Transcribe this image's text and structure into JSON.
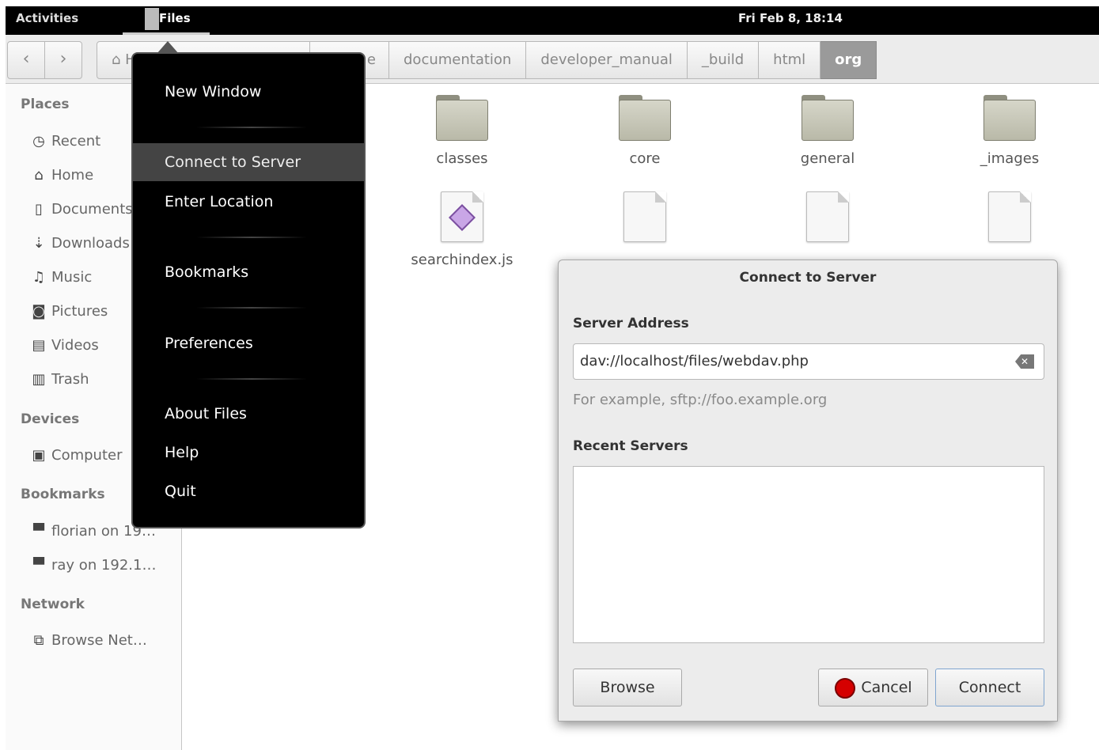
{
  "topbar": {
    "activities": "Activities",
    "app_name": "Files",
    "clock": "Fri Feb  8, 18:14"
  },
  "toolbar": {
    "back_icon": "chevron-left-icon",
    "forward_icon": "chevron-right-icon",
    "breadcrumbs": [
      {
        "label": "H",
        "icon": "home-icon"
      },
      {
        "label": "e"
      },
      {
        "label": "documentation"
      },
      {
        "label": "developer_manual"
      },
      {
        "label": "_build"
      },
      {
        "label": "html"
      },
      {
        "label": "org",
        "active": true
      }
    ]
  },
  "sidebar": {
    "places_header": "Places",
    "places": [
      {
        "label": "Recent",
        "icon": "clock-icon"
      },
      {
        "label": "Home",
        "icon": "home-icon"
      },
      {
        "label": "Documents",
        "icon": "document-icon"
      },
      {
        "label": "Downloads",
        "icon": "download-icon"
      },
      {
        "label": "Music",
        "icon": "music-icon"
      },
      {
        "label": "Pictures",
        "icon": "camera-icon"
      },
      {
        "label": "Videos",
        "icon": "film-icon"
      },
      {
        "label": "Trash",
        "icon": "trash-icon"
      }
    ],
    "devices_header": "Devices",
    "devices": [
      {
        "label": "Computer",
        "icon": "computer-icon"
      }
    ],
    "bookmarks_header": "Bookmarks",
    "bookmarks": [
      {
        "label": "florian on 19…",
        "icon": "network-share-icon"
      },
      {
        "label": "ray on 192.1…",
        "icon": "network-share-icon"
      }
    ],
    "network_header": "Network",
    "network": [
      {
        "label": "Browse Net…",
        "icon": "network-icon"
      }
    ]
  },
  "files": [
    {
      "name": "classes",
      "type": "folder"
    },
    {
      "name": "core",
      "type": "folder"
    },
    {
      "name": "general",
      "type": "folder"
    },
    {
      "name": "_images",
      "type": "folder"
    },
    {
      "name": "searchindex.js",
      "type": "script"
    }
  ],
  "app_menu": {
    "items": [
      {
        "label": "New Window"
      },
      {
        "label": "Connect to Server",
        "selected": true
      },
      {
        "label": "Enter Location"
      },
      {
        "label": "Bookmarks"
      },
      {
        "label": "Preferences"
      },
      {
        "label": "About Files"
      },
      {
        "label": "Help"
      },
      {
        "label": "Quit"
      }
    ]
  },
  "dialog": {
    "title": "Connect to Server",
    "server_address_label": "Server Address",
    "server_address_value": "dav://localhost/files/webdav.php",
    "hint": "For example, sftp://foo.example.org",
    "recent_label": "Recent Servers",
    "browse": "Browse",
    "cancel": "Cancel",
    "connect": "Connect"
  }
}
